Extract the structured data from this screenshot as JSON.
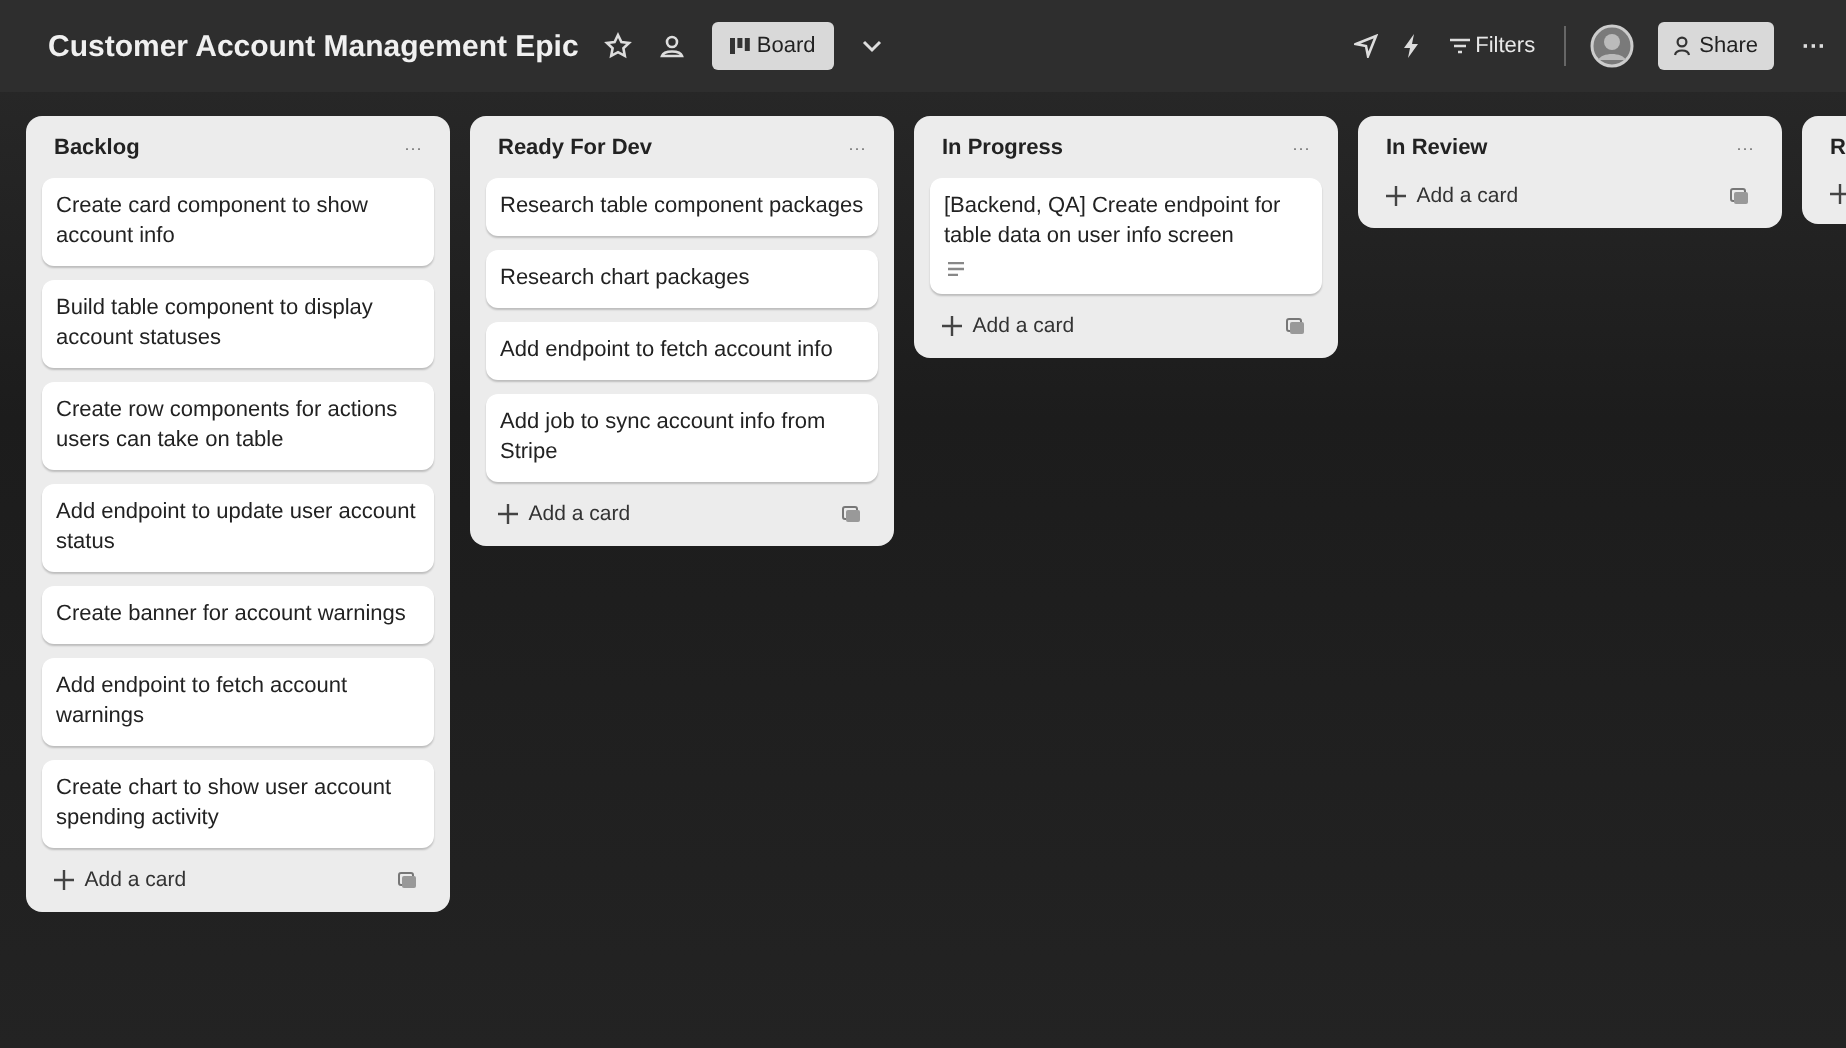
{
  "header": {
    "title": "Customer Account Management Epic",
    "view_button": "Board",
    "filters_label": "Filters",
    "share_label": "Share",
    "more": "···"
  },
  "lists": [
    {
      "title": "Backlog",
      "more": "···",
      "add_label": "Add a card",
      "cards": [
        {
          "text": "Create card component to show account info",
          "has_description": false
        },
        {
          "text": "Build table component to display account statuses",
          "has_description": false
        },
        {
          "text": "Create row components for actions users can take on table",
          "has_description": false
        },
        {
          "text": "Add endpoint to update user account status",
          "has_description": false
        },
        {
          "text": "Create banner for account warnings",
          "has_description": false
        },
        {
          "text": "Add endpoint to fetch account warnings",
          "has_description": false
        },
        {
          "text": "Create chart to show user account spending activity",
          "has_description": false
        }
      ]
    },
    {
      "title": "Ready For Dev",
      "more": "···",
      "add_label": "Add a card",
      "cards": [
        {
          "text": "Research table component packages",
          "has_description": false
        },
        {
          "text": "Research chart packages",
          "has_description": false
        },
        {
          "text": "Add endpoint to fetch account info",
          "has_description": false
        },
        {
          "text": "Add job to sync account info from Stripe",
          "has_description": false
        }
      ]
    },
    {
      "title": "In Progress",
      "more": "···",
      "add_label": "Add a card",
      "cards": [
        {
          "text": "[Backend, QA] Create endpoint for table data on user info screen",
          "has_description": true
        }
      ]
    },
    {
      "title": "In Review",
      "more": "···",
      "add_label": "Add a card"
    },
    {
      "title": "R"
    }
  ]
}
